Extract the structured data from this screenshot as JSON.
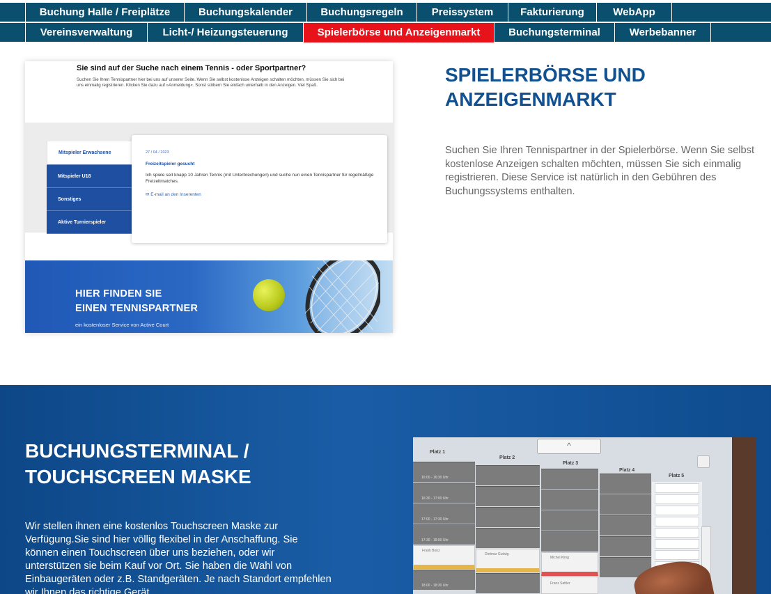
{
  "nav": {
    "row1": [
      {
        "label": "Buchung Halle / Freiplätze"
      },
      {
        "label": "Buchungskalender"
      },
      {
        "label": "Buchungsregeln"
      },
      {
        "label": "Preissystem"
      },
      {
        "label": "Fakturierung"
      },
      {
        "label": "WebApp"
      }
    ],
    "row2": [
      {
        "label": "Vereinsverwaltung"
      },
      {
        "label": "Licht-/ Heizungsteuerung"
      },
      {
        "label": "Spielerbörse und Anzeigenmarkt",
        "active": true
      },
      {
        "label": "Buchungsterminal"
      },
      {
        "label": "Werbebanner"
      }
    ],
    "color": "#0a4f6e",
    "active_color": "#e8121a"
  },
  "section1": {
    "screenshot": {
      "heading": "Sie sind auf der Suche nach einem Tennis - oder Sportpartner?",
      "intro": "Suchen Sie Ihren Tennispartner hier bei uns auf unserer Seite. Wenn Sie selbst kostenlose Anzeigen schalten möchten, müssen Sie sich bei uns einmalig registrieren. Klicken Sie dazu auf »Anmeldung«. Sonst stöbern Sie einfach unterhalb in den Anzeigen. Viel Spaß.",
      "tabs": [
        "Mitspieler Erwachsene",
        "Mitspieler U18",
        "Sonstiges",
        "Aktive Turnierspieler"
      ],
      "ad": {
        "date": "27 / 04 / 2023",
        "title": "Freizeitspieler gesucht",
        "text": "Ich spiele seit knapp 10 Jahren Tennis (mit Unterbrechungen) und suche nun einen Tennispartner für regelmäßige Freizeitmatches.",
        "mail": "✉ E-mail an den Inserenten"
      },
      "banner": {
        "line1": "HIER FINDEN SIE",
        "line2": "EINEN TENNISPARTNER",
        "sub": "ein kostenloser Service von Active Court"
      }
    },
    "title_line1": "SPIELERBÖRSE UND",
    "title_line2": "ANZEIGENMARKT",
    "text": "Suchen Sie Ihren Tennispartner in der Spielerbörse. Wenn Sie selbst kostenlose Anzeigen schalten möchten, müssen Sie sich einmalig registrieren. Diese Service ist natürlich in den Gebühren des Buchungssystems enthalten."
  },
  "section2": {
    "title_line1": "BUCHUNGSTERMINAL /",
    "title_line2": "TOUCHSCREEN MASKE",
    "text": "Wir stellen ihnen eine kostenlos Touchscreen Maske zur Verfügung.Sie sind hier völlig flexibel in der Anschaffung. Sie können einen Touchscreen über uns beziehen, oder wir unterstützen sie beim Kauf vor Ort. Sie haben die Wahl von Einbaugeräten oder z.B. Standgeräten. Je nach Standort empfehlen wir Ihnen das richtige Gerät.",
    "terminal": {
      "up_arrow": "^",
      "courts": [
        "Platz 1",
        "Platz 2",
        "Platz 3",
        "Platz 4",
        "Platz 5"
      ],
      "times": [
        "16:00 - 16:30 Uhr",
        "16:30 - 17:00 Uhr",
        "17:00 - 17:30 Uhr",
        "17:30 - 18:00 Uhr",
        "18:00 - 18:30 Uhr"
      ],
      "names": [
        "Frank Bonz",
        "Dietmar Gutwig",
        "Michel Kling",
        "Franz Sattler"
      ]
    }
  }
}
